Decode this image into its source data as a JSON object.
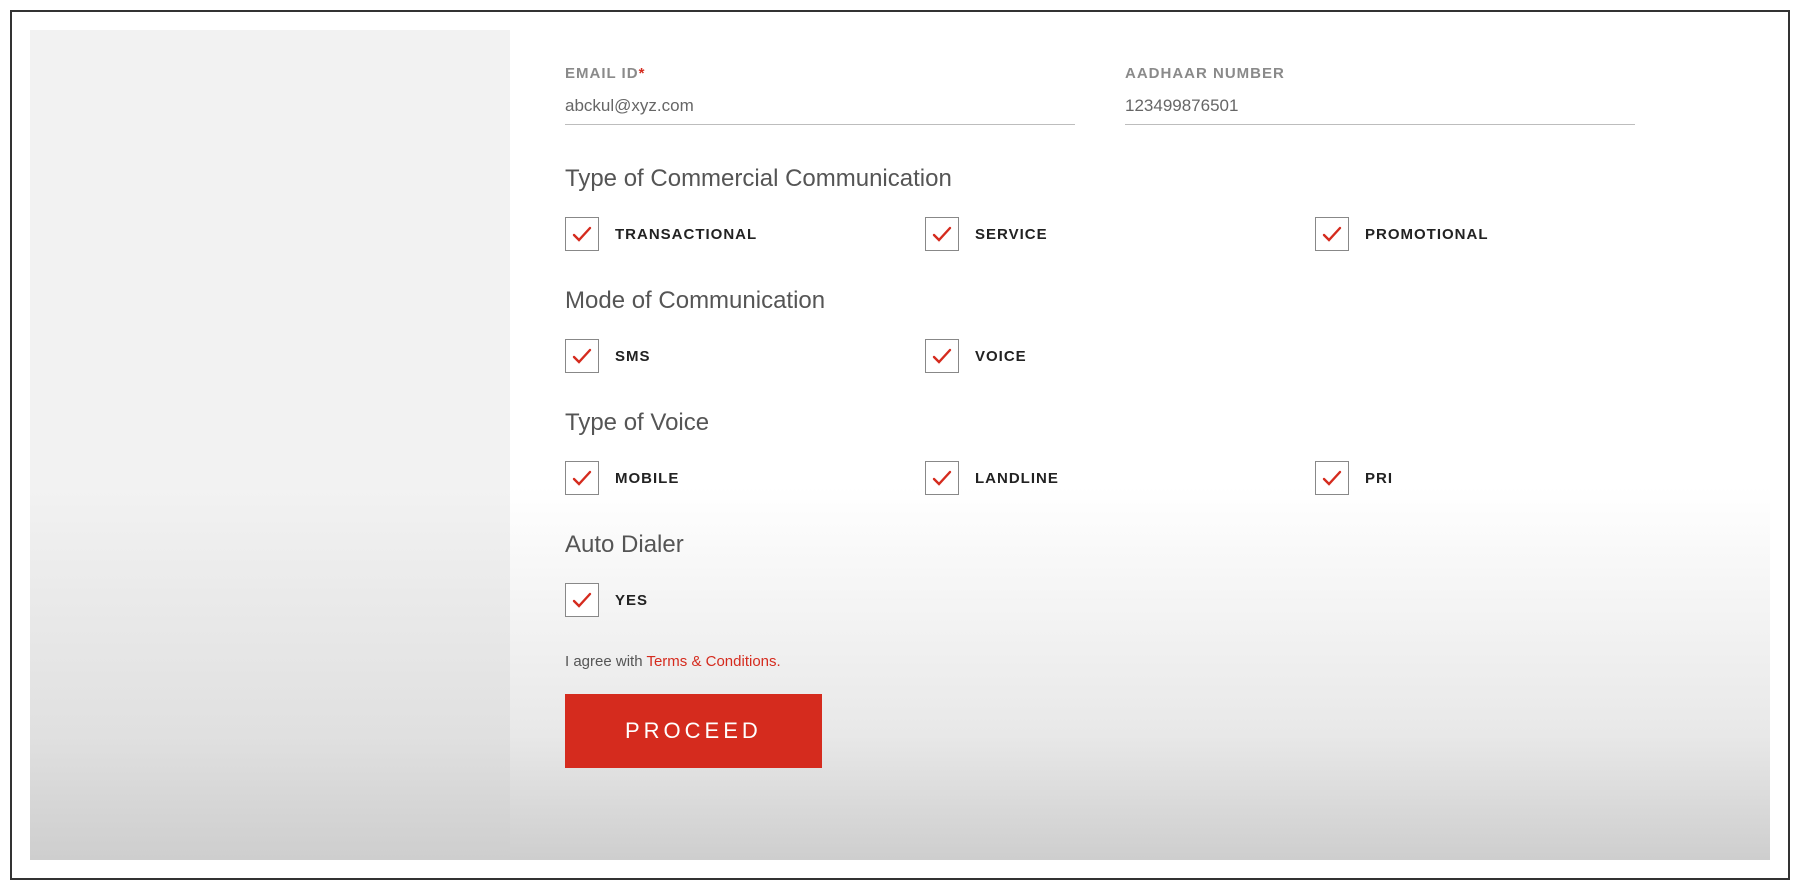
{
  "fields": {
    "email": {
      "label": "EMAIL ID",
      "required_mark": "*",
      "value": "abckul@xyz.com"
    },
    "aadhaar": {
      "label": "AADHAAR NUMBER",
      "value": "123499876501"
    }
  },
  "sections": {
    "commercial": {
      "heading": "Type of Commercial Communication",
      "options": {
        "transactional": "TRANSACTIONAL",
        "service": "SERVICE",
        "promotional": "PROMOTIONAL"
      }
    },
    "mode": {
      "heading": "Mode of Communication",
      "options": {
        "sms": "SMS",
        "voice": "VOICE"
      }
    },
    "voice_type": {
      "heading": "Type of Voice",
      "options": {
        "mobile": "MOBILE",
        "landline": "LANDLINE",
        "pri": "PRI"
      }
    },
    "auto_dialer": {
      "heading": "Auto Dialer",
      "options": {
        "yes": "YES"
      }
    }
  },
  "agree": {
    "prefix": "I agree with ",
    "link": "Terms & Conditions."
  },
  "buttons": {
    "proceed": "PROCEED"
  }
}
